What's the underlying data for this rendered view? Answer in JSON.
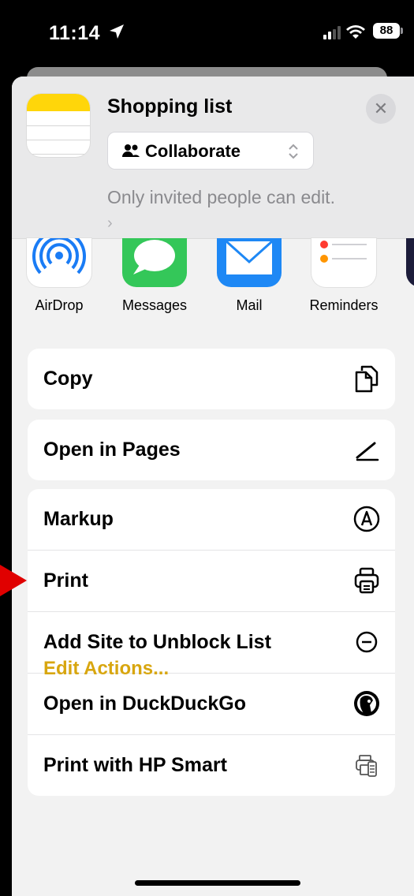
{
  "status_bar": {
    "time": "11:14",
    "battery": "88"
  },
  "header": {
    "title": "Shopping list",
    "collaborate_label": "Collaborate",
    "subtitle": "Only invited people can edit.",
    "subtitle_chevron": "›",
    "close_symbol": "✕"
  },
  "apps": [
    {
      "label": "AirDrop"
    },
    {
      "label": "Messages"
    },
    {
      "label": "Mail"
    },
    {
      "label": "Reminders"
    }
  ],
  "actions": {
    "group1": [
      {
        "label": "Copy",
        "icon": "copy-icon"
      }
    ],
    "group2": [
      {
        "label": "Open in Pages",
        "icon": "pages-pen-icon"
      }
    ],
    "group3": [
      {
        "label": "Markup",
        "icon": "markup-icon"
      },
      {
        "label": "Print",
        "icon": "printer-icon"
      },
      {
        "label": "Add Site to Unblock List",
        "icon": "minus-circle-icon"
      },
      {
        "label": "Open in DuckDuckGo",
        "icon": "duckduckgo-icon"
      },
      {
        "label": "Print with HP Smart",
        "icon": "hp-smart-icon"
      }
    ]
  },
  "edit_actions_label": "Edit Actions...",
  "colors": {
    "accent": "#d8a60f",
    "notes_yellow": "#ffd60a",
    "messages_green": "#34c759",
    "mail_blue": "#1e88f5",
    "pointer_red": "#e00000"
  }
}
